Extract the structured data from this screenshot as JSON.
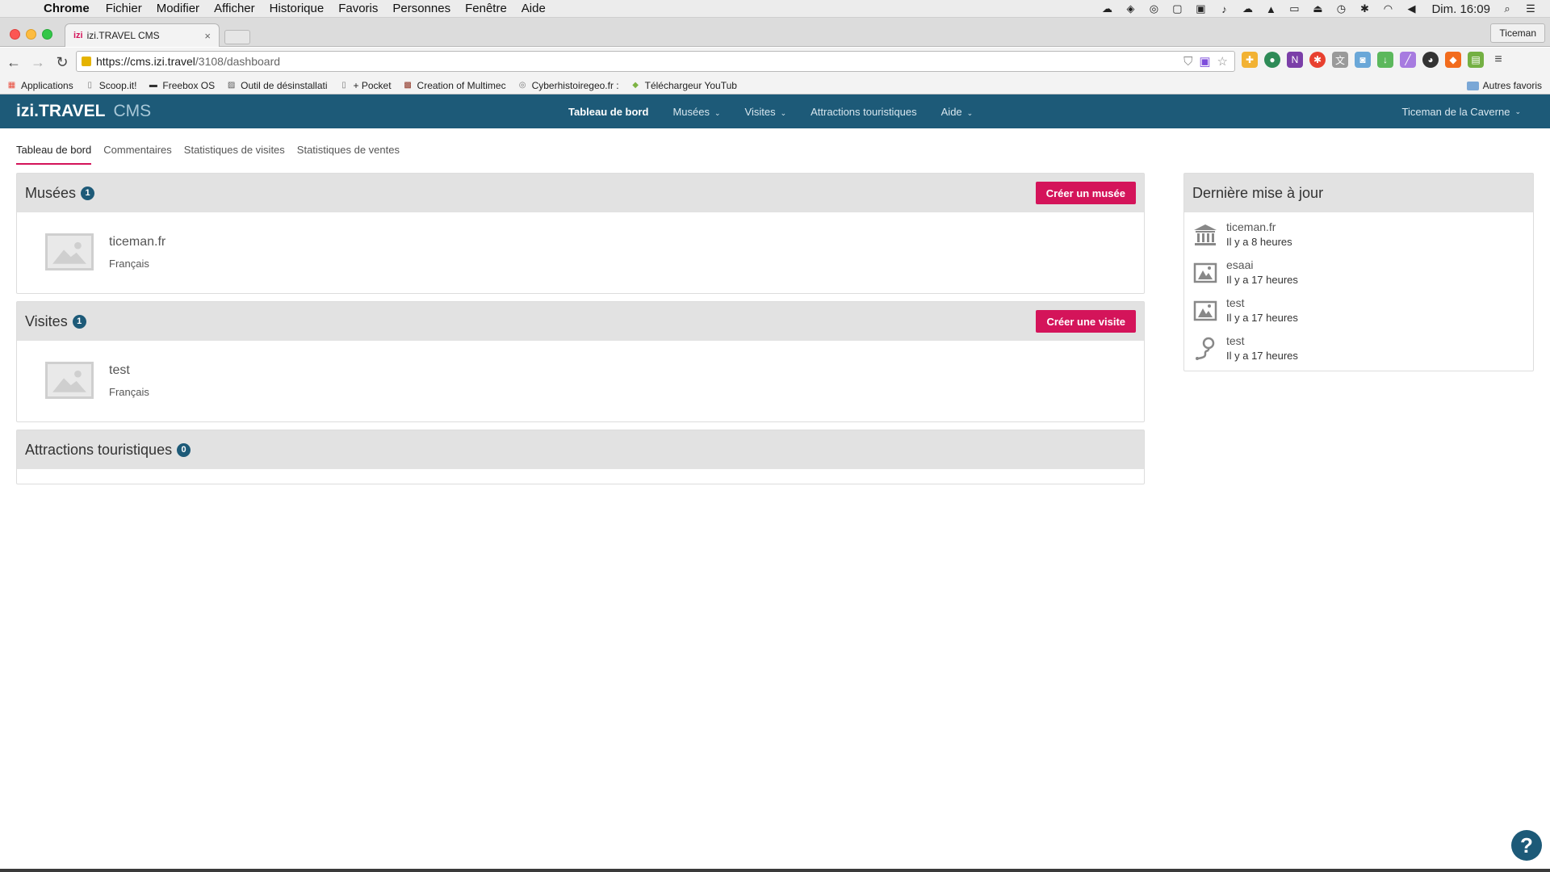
{
  "macos_menubar": {
    "apple": "",
    "items": [
      "Chrome",
      "Fichier",
      "Modifier",
      "Afficher",
      "Historique",
      "Favoris",
      "Personnes",
      "Fenêtre",
      "Aide"
    ],
    "clock": "Dim. 16:09"
  },
  "browser": {
    "tab_title": "izi.TRAVEL CMS",
    "tab_favicon": "izi",
    "profile": "Ticeman",
    "url_host": "https://cms.izi.travel",
    "url_path": "/3108/dashboard",
    "bookmarks": [
      {
        "label": "Applications",
        "icon": "apps-grid-icon"
      },
      {
        "label": "Scoop.it!",
        "icon": "page-icon"
      },
      {
        "label": "Freebox OS",
        "icon": "freebox-icon"
      },
      {
        "label": "Outil de désinstallati",
        "icon": "tool-icon"
      },
      {
        "label": "+ Pocket",
        "icon": "page-icon"
      },
      {
        "label": "Creation of Multimec",
        "icon": "image-icon"
      },
      {
        "label": "Cyberhistoiregeo.fr :",
        "icon": "globe-icon"
      },
      {
        "label": "Téléchargeur YouTub",
        "icon": "download-icon"
      }
    ],
    "other_bookmarks": "Autres favoris"
  },
  "app": {
    "logo": "izi.TRAVEL",
    "logo_suffix": "CMS",
    "menu": [
      {
        "label": "Tableau de bord",
        "active": true,
        "dropdown": false
      },
      {
        "label": "Musées",
        "active": false,
        "dropdown": true
      },
      {
        "label": "Visites",
        "active": false,
        "dropdown": true
      },
      {
        "label": "Attractions touristiques",
        "active": false,
        "dropdown": false
      },
      {
        "label": "Aide",
        "active": false,
        "dropdown": true
      }
    ],
    "user": "Ticeman de la Caverne",
    "caret": "⌄"
  },
  "subtabs": [
    "Tableau de bord",
    "Commentaires",
    "Statistiques de visites",
    "Statistiques de ventes"
  ],
  "museums": {
    "title": "Musées",
    "count": "1",
    "create_label": "Créer un musée",
    "items": [
      {
        "name": "ticeman.fr",
        "lang": "Français"
      }
    ]
  },
  "visits": {
    "title": "Visites",
    "count": "1",
    "create_label": "Créer une visite",
    "items": [
      {
        "name": "test",
        "lang": "Français"
      }
    ]
  },
  "attractions": {
    "title": "Attractions touristiques",
    "count": "0"
  },
  "latest": {
    "title": "Dernière mise à jour",
    "items": [
      {
        "name": "ticeman.fr",
        "time": "Il y a 8 heures",
        "icon": "museum-icon"
      },
      {
        "name": "esaai",
        "time": "Il y a 17 heures",
        "icon": "exhibit-icon"
      },
      {
        "name": "test",
        "time": "Il y a 17 heures",
        "icon": "exhibit-icon"
      },
      {
        "name": "test",
        "time": "Il y a 17 heures",
        "icon": "tour-route-icon"
      }
    ]
  },
  "help": "?",
  "colors": {
    "brand": "#1d5a78",
    "accent": "#d4145a"
  }
}
